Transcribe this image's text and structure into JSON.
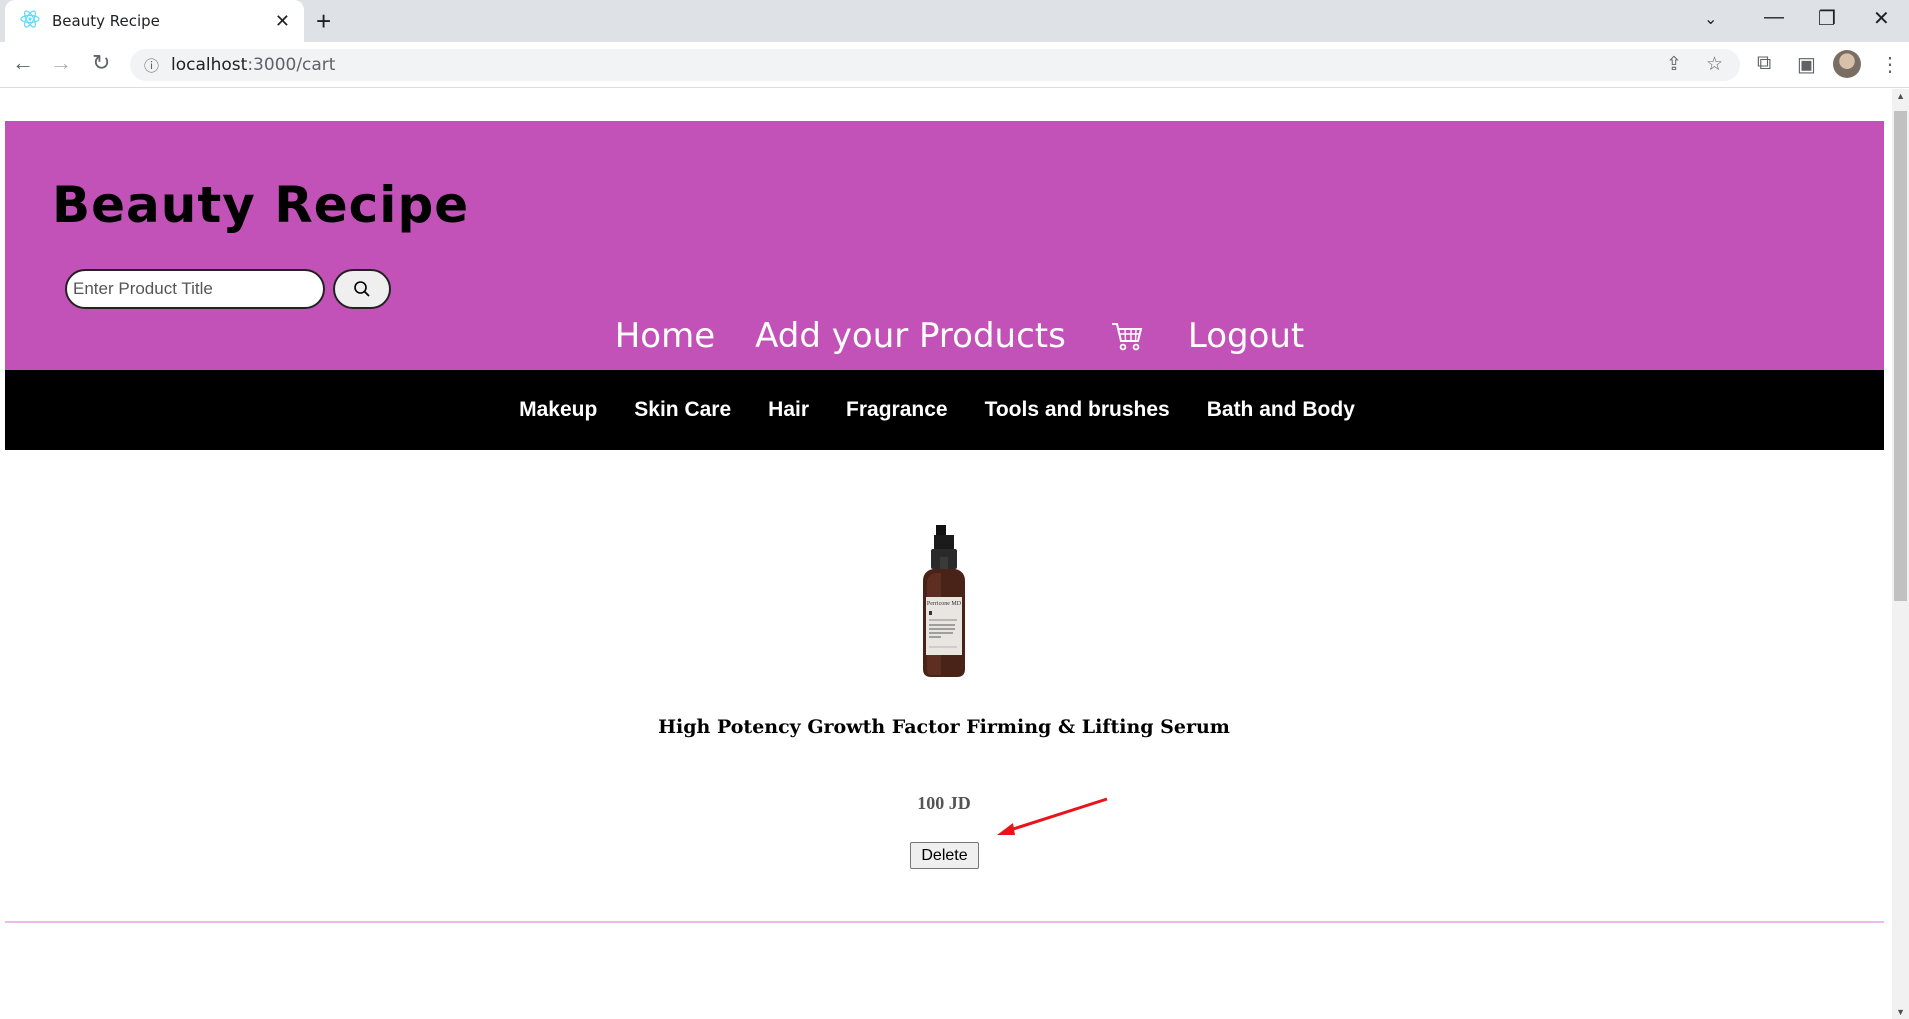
{
  "browser": {
    "tab_title": "Beauty Recipe",
    "url_host": "localhost",
    "url_rest": ":3000/cart"
  },
  "header": {
    "brand": "Beauty Recipe",
    "search_placeholder": "Enter Product Title",
    "nav": {
      "home": "Home",
      "add_products": "Add your Products",
      "logout": "Logout"
    },
    "background_color": "#c252b8"
  },
  "categories": [
    "Makeup",
    "Skin Care",
    "Hair",
    "Fragrance",
    "Tools and brushes",
    "Bath and Body"
  ],
  "cart_item": {
    "title": "High Potency Growth Factor Firming & Lifting Serum",
    "price": "100 JD",
    "delete_label": "Delete",
    "bottle_brand": "Perricone MD"
  },
  "colors": {
    "category_bar": "#000000",
    "annotation_arrow": "#e8131b"
  }
}
